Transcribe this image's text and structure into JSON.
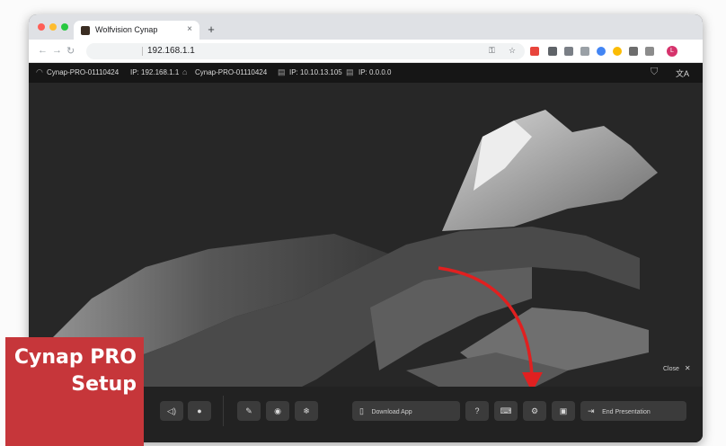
{
  "browser": {
    "tab_title": "Wolfvision Cynap",
    "tab_close": "×",
    "new_tab": "+",
    "url": "192.168.1.1",
    "profile_initial": "L",
    "back": "←",
    "forward": "→",
    "reload": "↻"
  },
  "status": {
    "wifi_name": "Cynap-PRO-01110424",
    "wifi_ip": "IP: 192.168.1.1",
    "lan_name": "Cynap-PRO-01110424",
    "lan_ip": "IP: 10.10.13.105",
    "lan2_ip": "IP: 0.0.0.0",
    "translate_icon": "文A"
  },
  "presentation": {
    "close_label": "Close",
    "close_glyph": "✕"
  },
  "toolbar": {
    "download_label": "Download App",
    "end_label": "End Presentation",
    "icons": {
      "volume": "◁)",
      "mic": "●",
      "annotate": "✎",
      "camera": "◉",
      "freeze": "❄",
      "help": "?",
      "keyboard": "⌨",
      "settings": "⚙",
      "screen": "▣",
      "phone": "▯",
      "exit": "⇥"
    }
  },
  "overlay": {
    "line1": "Cynap PRO",
    "line2": "Setup"
  },
  "colors": {
    "overlay_bg": "#c6363a",
    "arrow": "#e02020",
    "toolbar_bg": "#222222"
  }
}
